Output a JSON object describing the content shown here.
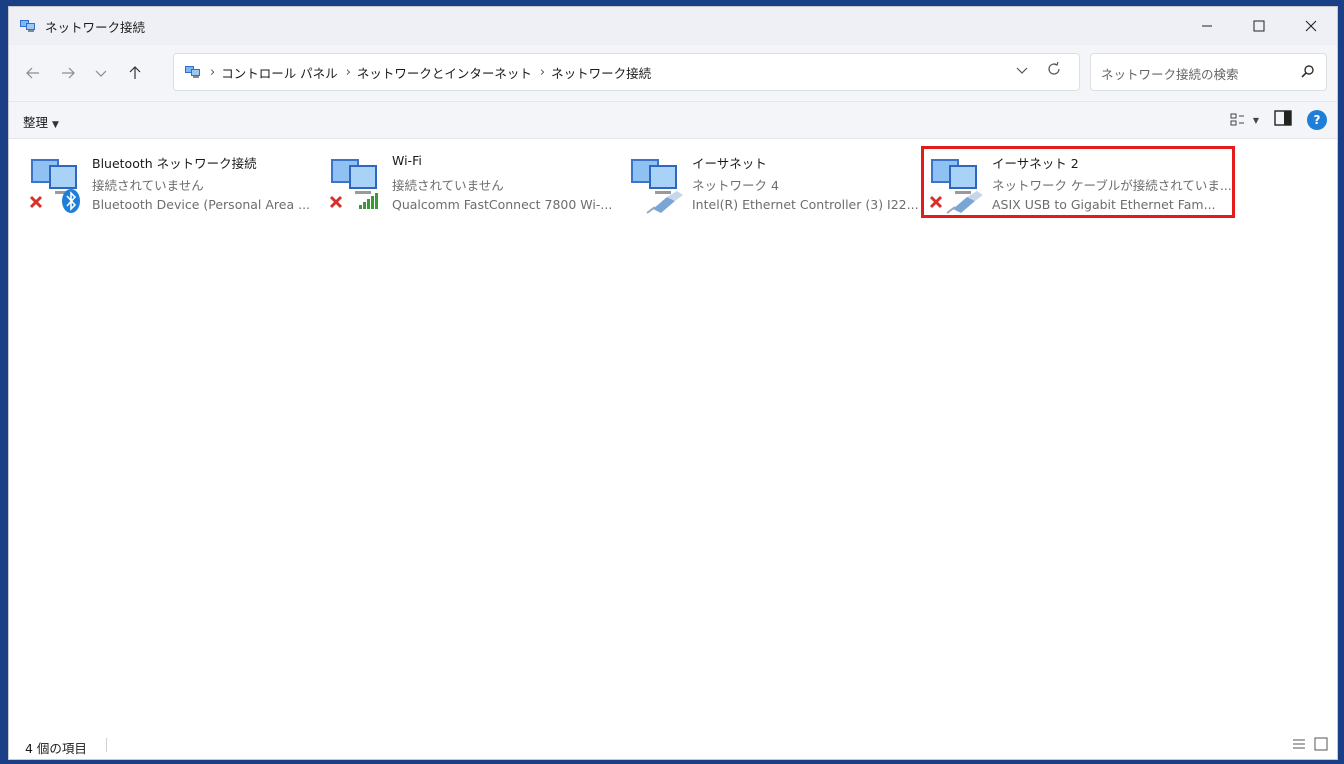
{
  "window": {
    "title": "ネットワーク接続"
  },
  "address": {
    "crumbs": [
      "コントロール パネル",
      "ネットワークとインターネット",
      "ネットワーク接続"
    ]
  },
  "search": {
    "placeholder": "ネットワーク接続の検索"
  },
  "toolbar": {
    "organize_label": "整理"
  },
  "items": [
    {
      "name": "Bluetooth ネットワーク接続",
      "status": "接続されていません",
      "device": "Bluetooth Device (Personal Area ...",
      "overlay": "bluetooth-icon",
      "disconnected": true
    },
    {
      "name": "Wi-Fi",
      "status": "接続されていません",
      "device": "Qualcomm FastConnect 7800 Wi-...",
      "overlay": "wifi-signal-icon",
      "disconnected": true
    },
    {
      "name": "イーサネット",
      "status": "ネットワーク 4",
      "device": "Intel(R) Ethernet Controller (3) I22...",
      "overlay": "ethernet-cable-icon",
      "disconnected": false
    },
    {
      "name": "イーサネット 2",
      "status": "ネットワーク ケーブルが接続されていま...",
      "device": "ASIX USB to Gigabit Ethernet Fam...",
      "overlay": "ethernet-cable-icon",
      "disconnected": true,
      "highlighted": true
    }
  ],
  "statusbar": {
    "count": "4 個の項目"
  },
  "colors": {
    "accent": "#1e7fd8",
    "highlight": "#e41b1b",
    "disconnected_x": "#d9302a"
  }
}
